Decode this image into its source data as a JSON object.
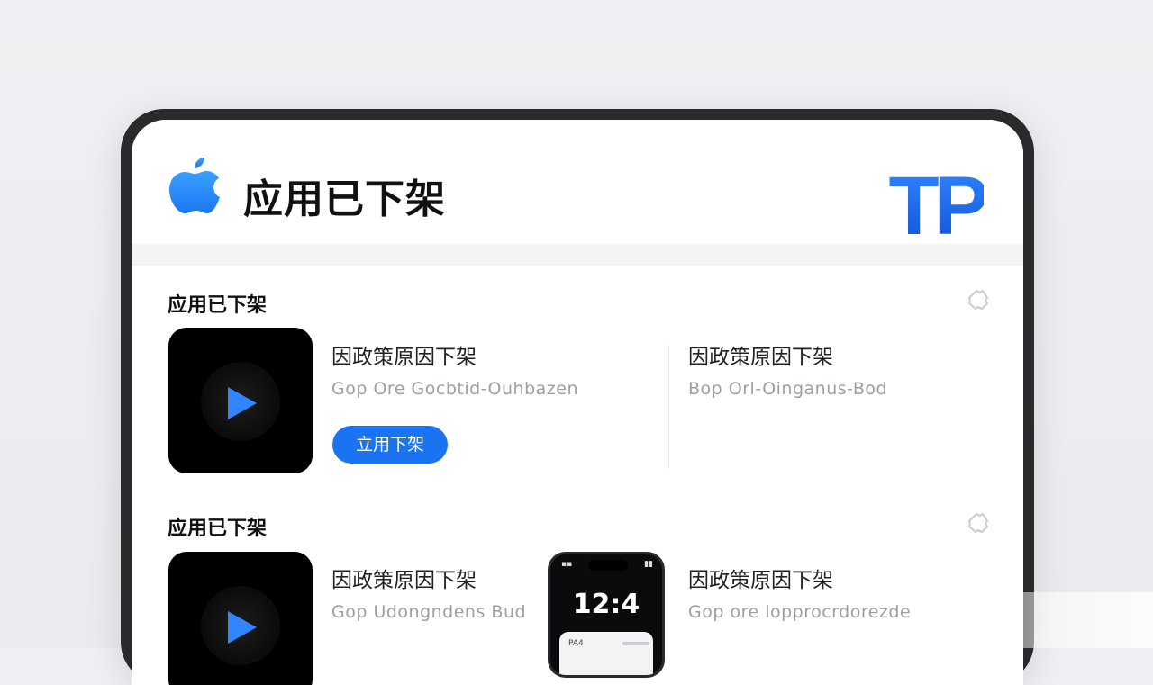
{
  "header": {
    "title": "应用已下架",
    "apple_icon": "apple-logo-icon",
    "brand_logo": "TP",
    "brand_color": "#1a6ff0"
  },
  "sections": [
    {
      "title": "应用已下架",
      "icon": "puzzle-icon",
      "items": [
        {
          "name": "因政策原因下架",
          "subtitle": "Gop Ore Gocbtid-Ouhbazen",
          "button": "立用下架",
          "icon": "play-icon"
        },
        {
          "name": "因政策原因下架",
          "subtitle": "Bop Orl-Oinganus-Bod"
        }
      ]
    },
    {
      "title": "应用已下架",
      "icon": "puzzle-icon",
      "items": [
        {
          "name": "因政策原因下架",
          "subtitle": "Gop Udongndens Bud",
          "icon": "play-icon"
        },
        {
          "name": "因政策原因下架",
          "subtitle": "Gop ore lopprocrdorezde",
          "thumbnail": {
            "time": "12:4",
            "card_label": "PA4"
          }
        }
      ]
    }
  ],
  "accent": "#1a73f0"
}
